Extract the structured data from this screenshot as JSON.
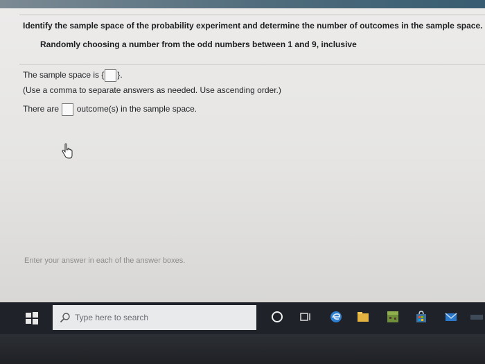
{
  "question": {
    "instruction": "Identify the sample space of the probability experiment and determine the number of outcomes in the sample space.",
    "problem": "Randomly choosing a number from the odd numbers between 1 and 9, inclusive"
  },
  "sample_space": {
    "prefix": "The sample space is {",
    "value": "",
    "suffix": "}.",
    "note": "(Use a comma to separate answers as needed. Use ascending order.)"
  },
  "outcomes": {
    "prefix": "There are",
    "value": "",
    "suffix": "outcome(s) in the sample space."
  },
  "footer": "Enter your answer in each of the answer boxes.",
  "taskbar": {
    "search_placeholder": "Type here to search",
    "colors": {
      "taskbar": "#1f2329",
      "edge": "#2f7fd1",
      "explorer": "#e3b341",
      "store": "#3f6f9c",
      "mail": "#2a78c9",
      "minecraft": "#6f8f3a"
    }
  }
}
